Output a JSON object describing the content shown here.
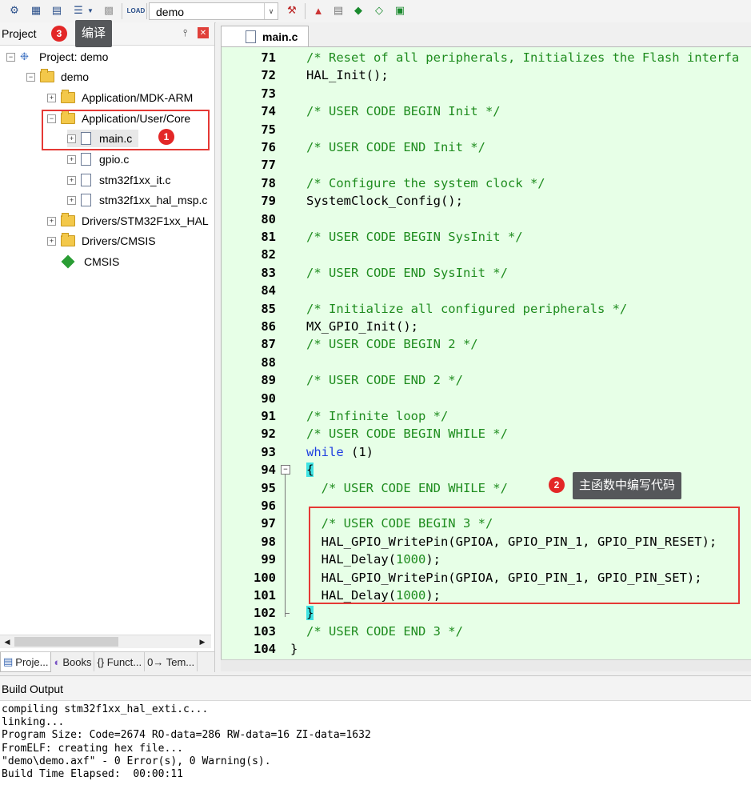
{
  "toolbar": {
    "target": "demo",
    "icons": [
      "translate-icon",
      "build-icon",
      "rebuild-icon",
      "batch-build-icon",
      "stop-build-icon",
      "download-icon",
      "target-options-icon",
      "manage-components-icon",
      "select-packs-icon",
      "pack-installer-icon"
    ]
  },
  "project": {
    "title": "Project",
    "annotation_badge": "3",
    "annotation_text": "编译",
    "tree": [
      {
        "label": "Project: demo"
      },
      {
        "label": "demo"
      },
      {
        "label": "Application/MDK-ARM"
      },
      {
        "label": "Application/User/Core"
      },
      {
        "label": "main.c",
        "badge": "1"
      },
      {
        "label": "gpio.c"
      },
      {
        "label": "stm32f1xx_it.c"
      },
      {
        "label": "stm32f1xx_hal_msp.c"
      },
      {
        "label": "Drivers/STM32F1xx_HAL"
      },
      {
        "label": "Drivers/CMSIS"
      },
      {
        "label": "CMSIS"
      }
    ],
    "tabs": [
      "Proje...",
      "Books",
      "{} Funct...",
      "0→ Tem..."
    ]
  },
  "editor": {
    "file_tab": "main.c",
    "annotation_badge": "2",
    "annotation_text": "主函数中编写代码",
    "lines": [
      {
        "n": "71",
        "segs": [
          {
            "t": "/* Reset of all peripherals, Initializes the Flash interfa",
            "c": "cm"
          }
        ]
      },
      {
        "n": "72",
        "segs": [
          {
            "t": "HAL_Init();",
            "c": ""
          }
        ]
      },
      {
        "n": "73",
        "segs": []
      },
      {
        "n": "74",
        "segs": [
          {
            "t": "/* USER CODE BEGIN Init */",
            "c": "cm"
          }
        ]
      },
      {
        "n": "75",
        "segs": []
      },
      {
        "n": "76",
        "segs": [
          {
            "t": "/* USER CODE END Init */",
            "c": "cm"
          }
        ]
      },
      {
        "n": "77",
        "segs": []
      },
      {
        "n": "78",
        "segs": [
          {
            "t": "/* Configure the system clock */",
            "c": "cm"
          }
        ]
      },
      {
        "n": "79",
        "segs": [
          {
            "t": "SystemClock_Config();",
            "c": ""
          }
        ]
      },
      {
        "n": "80",
        "segs": []
      },
      {
        "n": "81",
        "segs": [
          {
            "t": "/* USER CODE BEGIN SysInit */",
            "c": "cm"
          }
        ]
      },
      {
        "n": "82",
        "segs": []
      },
      {
        "n": "83",
        "segs": [
          {
            "t": "/* USER CODE END SysInit */",
            "c": "cm"
          }
        ]
      },
      {
        "n": "84",
        "segs": []
      },
      {
        "n": "85",
        "segs": [
          {
            "t": "/* Initialize all configured peripherals */",
            "c": "cm"
          }
        ]
      },
      {
        "n": "86",
        "segs": [
          {
            "t": "MX_GPIO_Init();",
            "c": ""
          }
        ]
      },
      {
        "n": "87",
        "segs": [
          {
            "t": "/* USER CODE BEGIN 2 */",
            "c": "cm"
          }
        ]
      },
      {
        "n": "88",
        "segs": []
      },
      {
        "n": "89",
        "segs": [
          {
            "t": "/* USER CODE END 2 */",
            "c": "cm"
          }
        ]
      },
      {
        "n": "90",
        "segs": []
      },
      {
        "n": "91",
        "segs": [
          {
            "t": "/* Infinite loop */",
            "c": "cm"
          }
        ]
      },
      {
        "n": "92",
        "segs": [
          {
            "t": "/* USER CODE BEGIN WHILE */",
            "c": "cm"
          }
        ]
      },
      {
        "n": "93",
        "segs": [
          {
            "t": "while",
            "c": "kw"
          },
          {
            "t": " (1)",
            "c": ""
          }
        ]
      },
      {
        "n": "94",
        "segs": [
          {
            "t": "{",
            "c": "brace"
          }
        ]
      },
      {
        "n": "95",
        "segs": [
          {
            "t": "  /* USER CODE END WHILE */",
            "c": "cm"
          }
        ]
      },
      {
        "n": "96",
        "segs": []
      },
      {
        "n": "97",
        "segs": [
          {
            "t": "  /* USER CODE BEGIN 3 */",
            "c": "cm"
          }
        ]
      },
      {
        "n": "98",
        "segs": [
          {
            "t": "  HAL_GPIO_WritePin(GPIOA, GPIO_PIN_1, GPIO_PIN_RESET);",
            "c": ""
          }
        ]
      },
      {
        "n": "99",
        "segs": [
          {
            "t": "  HAL_Delay(",
            "c": ""
          },
          {
            "t": "1000",
            "c": "num"
          },
          {
            "t": ");",
            "c": ""
          }
        ]
      },
      {
        "n": "100",
        "segs": [
          {
            "t": "  HAL_GPIO_WritePin(GPIOA, GPIO_PIN_1, GPIO_PIN_SET);",
            "c": ""
          }
        ]
      },
      {
        "n": "101",
        "segs": [
          {
            "t": "  HAL_Delay(",
            "c": ""
          },
          {
            "t": "1000",
            "c": "num"
          },
          {
            "t": ");",
            "c": ""
          }
        ]
      },
      {
        "n": "102",
        "segs": [
          {
            "t": "}",
            "c": "brace"
          }
        ]
      },
      {
        "n": "103",
        "segs": [
          {
            "t": "/* USER CODE END 3 */",
            "c": "cm"
          }
        ]
      },
      {
        "n": "104",
        "segs": [
          {
            "t": "}",
            "c": "outer"
          }
        ]
      }
    ]
  },
  "build": {
    "title": "Build Output",
    "lines": [
      "compiling stm32f1xx_hal_exti.c...",
      "linking...",
      "Program Size: Code=2674 RO-data=286 RW-data=16 ZI-data=1632",
      "FromELF: creating hex file...",
      "\"demo\\demo.axf\" - 0 Error(s), 0 Warning(s).",
      "Build Time Elapsed:  00:00:11"
    ]
  },
  "colors": {
    "editor_bg": "#e7ffe7",
    "comment": "#1e8c1e",
    "keyword": "#1d3fe0",
    "highlight_box": "#e53935",
    "badge": "#e32727"
  }
}
